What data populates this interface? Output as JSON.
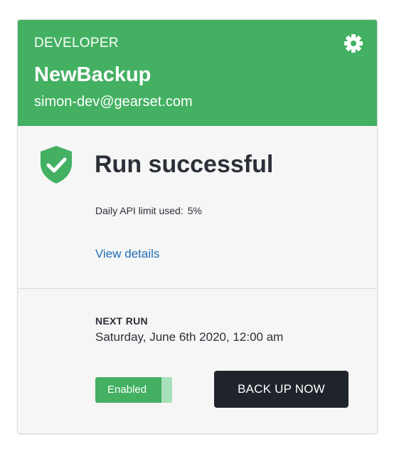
{
  "card": {
    "environment": "DEVELOPER",
    "name": "NewBackup",
    "account": "simon-dev@gearset.com",
    "settings_icon": "gear-icon",
    "status": {
      "icon": "shield-check-icon",
      "title": "Run successful",
      "api_limit_label": "Daily API limit used:",
      "api_limit_value": "5%",
      "view_details": "View details"
    },
    "schedule": {
      "next_run_label": "NEXT RUN",
      "next_run_time": "Saturday, June 6th 2020, 12:00 am",
      "toggle_label": "Enabled",
      "backup_button": "BACK UP NOW"
    }
  },
  "colors": {
    "accent": "#43b062",
    "header_text": "#ffffff",
    "body_bg": "#f6f6f6",
    "text_dark": "#2b3038",
    "link": "#1f6fb5",
    "button_dark": "#1f232b"
  }
}
